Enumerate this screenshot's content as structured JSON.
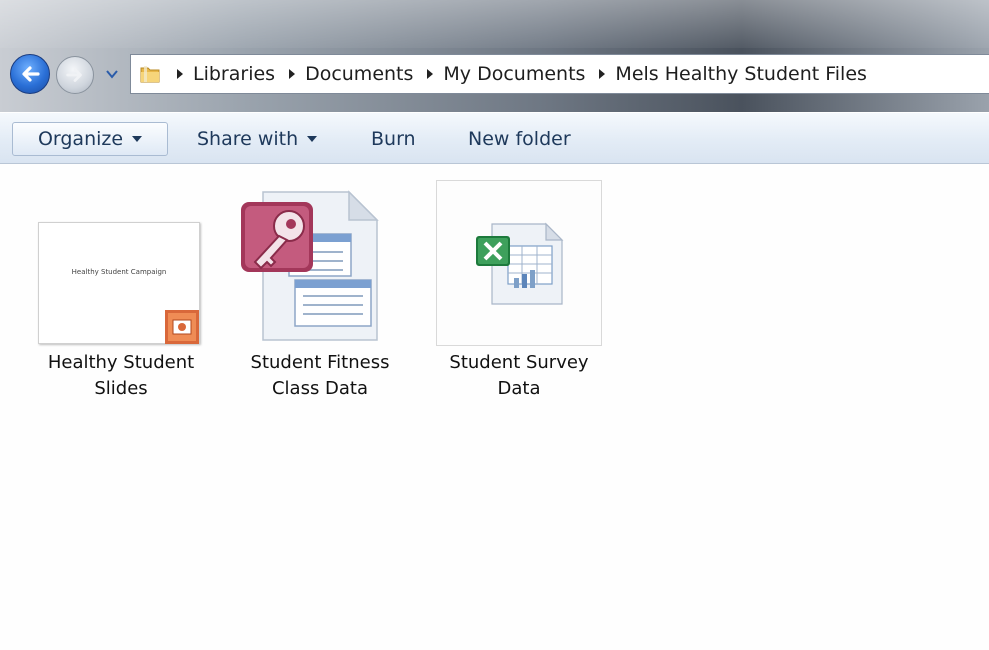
{
  "breadcrumb": [
    "Libraries",
    "Documents",
    "My Documents",
    "Mels Healthy Student Files"
  ],
  "icons": {
    "back": "back-arrow-icon",
    "forward": "forward-arrow-icon",
    "history": "chevron-down-icon",
    "folder": "folder-icon"
  },
  "toolbar": {
    "organize": "Organize",
    "share_with": "Share with",
    "burn": "Burn",
    "new_folder": "New folder"
  },
  "files": [
    {
      "line1": "Healthy Student",
      "line2": "Slides",
      "type": "powerpoint",
      "thumbnail_text": "Healthy Student Campaign"
    },
    {
      "line1": "Student Fitness",
      "line2": "Class Data",
      "type": "access"
    },
    {
      "line1": "Student Survey",
      "line2": "Data",
      "type": "excel"
    }
  ],
  "colors": {
    "toolbar_text": "#1e395b",
    "back_button": "#2a6fd6",
    "access": "#a3375a",
    "excel": "#1d7a3c",
    "powerpoint": "#c55a2a"
  }
}
